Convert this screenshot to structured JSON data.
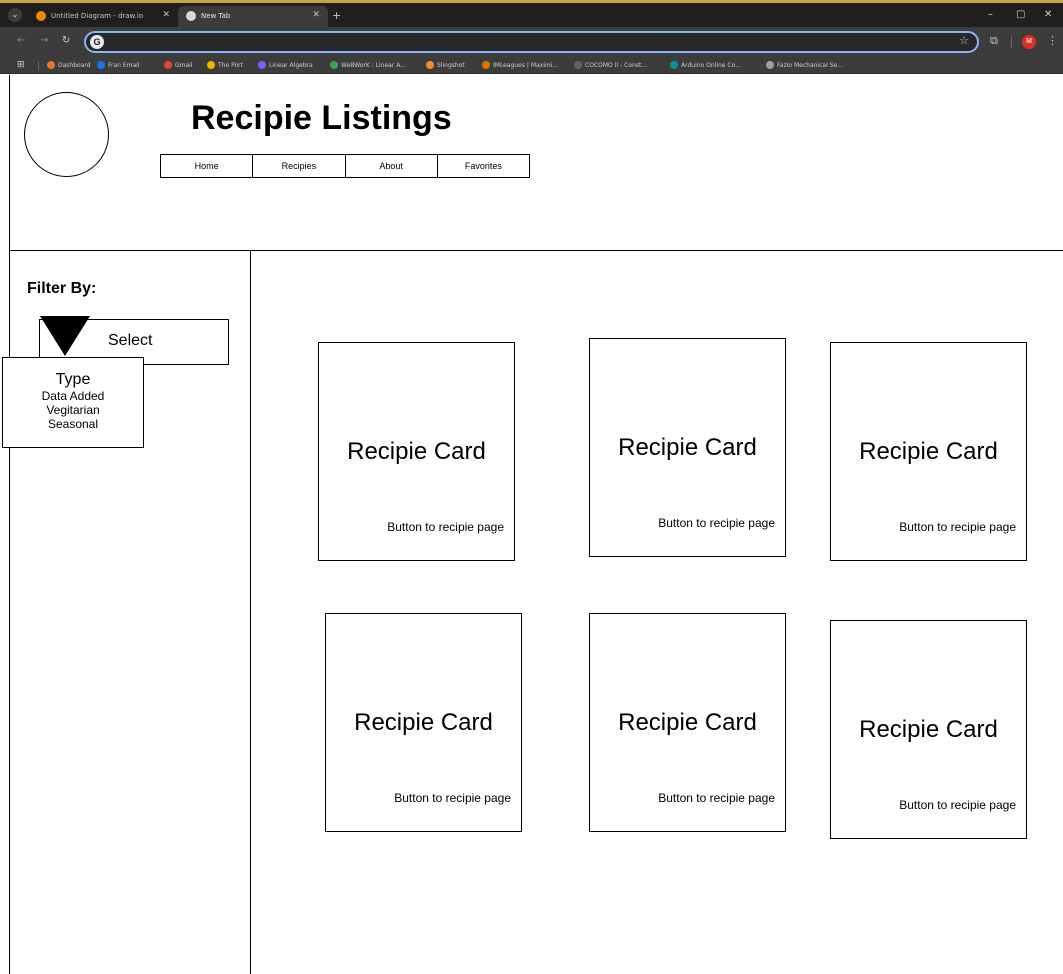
{
  "browser": {
    "tabs": [
      {
        "title": "Untitled Diagram - draw.io",
        "active": false
      },
      {
        "title": "New Tab",
        "active": true
      }
    ],
    "new_tab_label": "+",
    "window_controls": {
      "minimize": "–",
      "maximize": "▢",
      "close": "✕"
    },
    "nav": {
      "back": "←",
      "forward": "→",
      "reload": "↻"
    },
    "omnibox": {
      "engine_badge": "G",
      "value": "",
      "placeholder": ""
    },
    "profile_initial": "M",
    "bookmarks": [
      {
        "label": "Dashboard",
        "color": "#e8732a"
      },
      {
        "label": "Fran Email",
        "color": "#1a73e8"
      },
      {
        "label": "Gmail",
        "color": "#ea4335"
      },
      {
        "label": "The Port",
        "color": "#f4b400"
      },
      {
        "label": "Linear Algebra",
        "color": "#7b61ff"
      },
      {
        "label": "WeBWorK : Linear A...",
        "color": "#34a853"
      },
      {
        "label": "Slingshot",
        "color": "#f28b30"
      },
      {
        "label": "IMLeagues | Maximi...",
        "color": "#e37400"
      },
      {
        "label": "COCOMO II - Const...",
        "color": "#5f6368"
      },
      {
        "label": "Arduino Online Co...",
        "color": "#00979d"
      },
      {
        "label": "Fazio Mechanical Se...",
        "color": "#9aa0a6"
      }
    ]
  },
  "page": {
    "title": "Recipie Listings",
    "nav": [
      "Home",
      "Recipies",
      "About",
      "Favorites"
    ],
    "filter": {
      "label": "Filter By:",
      "select_label": "Select",
      "dropdown_title": "Type",
      "options": [
        "Data Added",
        "Vegitarian",
        "Seasonal"
      ]
    },
    "cards": [
      {
        "title": "Recipie Card",
        "button": "Button to recipie page"
      },
      {
        "title": "Recipie Card",
        "button": "Button to recipie page"
      },
      {
        "title": "Recipie Card",
        "button": "Button to recipie page"
      },
      {
        "title": "Recipie Card",
        "button": "Button to recipie page"
      },
      {
        "title": "Recipie Card",
        "button": "Button to recipie page"
      },
      {
        "title": "Recipie Card",
        "button": "Button to recipie page"
      }
    ]
  }
}
